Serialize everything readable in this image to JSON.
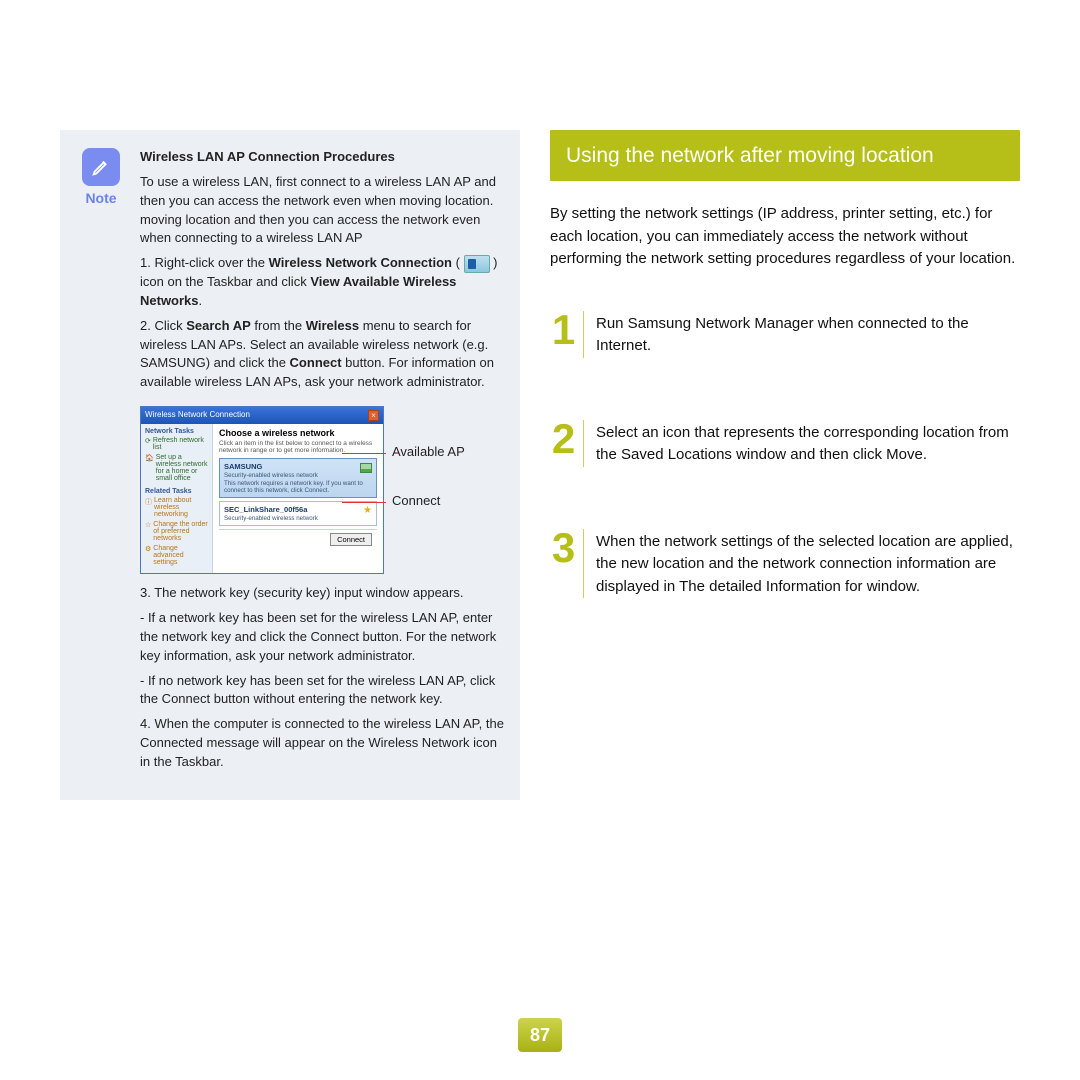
{
  "note": {
    "label": "Note",
    "title": "Wireless LAN AP Connection Procedures",
    "intro": "To use a wireless LAN, first connect to a wireless LAN AP and then you can access the network even when moving location. moving location and then you can access the network even when connecting to a wireless LAN AP",
    "step1_pre": "1. Right-click over the ",
    "step1_b1": "Wireless Network Connection",
    "step1_mid": " ( ",
    "step1_post": " ) icon on the Taskbar and click ",
    "step1_b2": "View Available Wireless Networks",
    "step1_end": ".",
    "step2_pre": "2. Click ",
    "step2_b1": "Search AP",
    "step2_mid1": " from the ",
    "step2_b2": "Wireless",
    "step2_mid2": " menu to search for wireless LAN APs. Select an available wireless network (e.g. SAMSUNG) and click the ",
    "step2_b3": "Connect",
    "step2_post": " button. For information on available wireless LAN APs, ask your network administrator.",
    "callout_ap": "Available AP",
    "callout_connect": "Connect",
    "step3": "3. The network key (security key) input window appears.",
    "step3a": "- If a network key has been set for the wireless LAN AP, enter the network key and click the Connect button. For the network key information, ask your network administrator.",
    "step3b": "- If no network key has been set for the wireless LAN AP, click the Connect button without entering the network key.",
    "step4": "4. When the computer is connected to the wireless LAN AP, the Connected message will appear on the Wireless Network icon in the Taskbar."
  },
  "wnc": {
    "title": "Wireless Network Connection",
    "side_hd1": "Network Tasks",
    "side_it1": "Refresh network list",
    "side_it2": "Set up a wireless network for a home or small office",
    "side_hd2": "Related Tasks",
    "side_it3": "Learn about wireless networking",
    "side_it4": "Change the order of preferred networks",
    "side_it5": "Change advanced settings",
    "main_hd": "Choose a wireless network",
    "main_desc": "Click an item in the list below to connect to a wireless network in range or to get more information.",
    "net1_name": "SAMSUNG",
    "net1_desc": "Security-enabled wireless network",
    "net1_info": "This network requires a network key. If you want to connect to this network, click Connect.",
    "net2_name": "SEC_LinkShare_00f56a",
    "net2_desc": "Security-enabled wireless network",
    "btn_connect": "Connect"
  },
  "right": {
    "title": "Using the network after moving location",
    "intro": "By setting the network settings (IP address, printer setting, etc.) for each location, you can immediately access the network without performing the network setting procedures regardless of your location.",
    "steps": [
      {
        "n": "1",
        "t": "Run Samsung Network Manager when connected to the Internet."
      },
      {
        "n": "2",
        "t": "Select an icon that represents the corresponding location from the Saved Locations window and then click Move."
      },
      {
        "n": "3",
        "t": "When the network settings of the selected location are applied, the new location and the network connection information are displayed in The detailed Information for window."
      }
    ]
  },
  "page_number": "87"
}
